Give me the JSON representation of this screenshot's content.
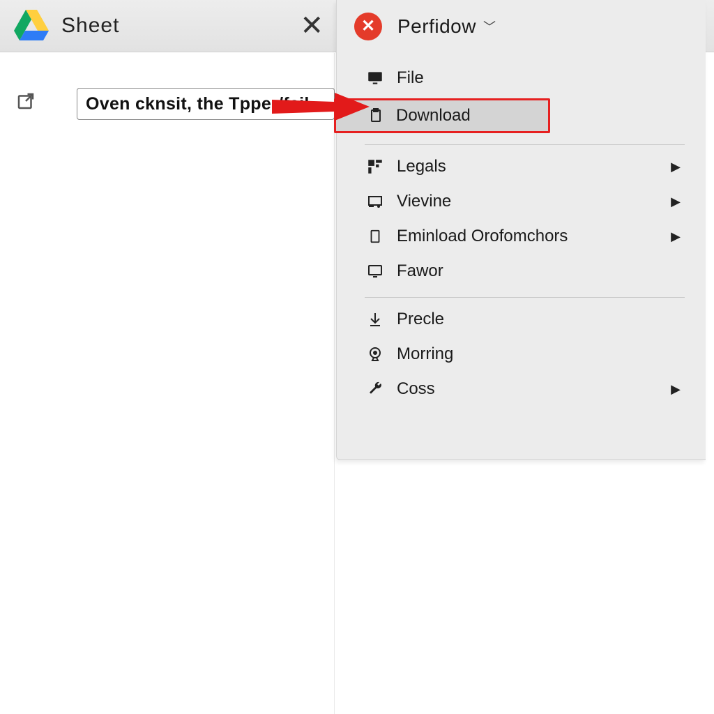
{
  "header": {
    "title": "Sheet"
  },
  "textbox": {
    "value": "Oven cknsit, the Tpper/fail"
  },
  "menu": {
    "title": "Perfidow",
    "groups": [
      {
        "items": [
          {
            "icon": "monitor-icon",
            "label": "File",
            "arrow": false,
            "highlight": false
          },
          {
            "icon": "clipboard-icon",
            "label": "Download",
            "arrow": false,
            "highlight": true
          }
        ]
      },
      {
        "items": [
          {
            "icon": "dashboard-icon",
            "label": "Legals",
            "arrow": true,
            "highlight": false
          },
          {
            "icon": "layout-icon",
            "label": "Vievine",
            "arrow": true,
            "highlight": false
          },
          {
            "icon": "page-icon",
            "label": "Eminload Orofomchors",
            "arrow": true,
            "highlight": false
          },
          {
            "icon": "screen-icon",
            "label": "Fawor",
            "arrow": false,
            "highlight": false
          }
        ]
      },
      {
        "items": [
          {
            "icon": "download-icon",
            "label": "Precle",
            "arrow": false,
            "highlight": false
          },
          {
            "icon": "webcam-icon",
            "label": "Morring",
            "arrow": false,
            "highlight": false
          },
          {
            "icon": "wrench-icon",
            "label": "Coss",
            "arrow": true,
            "highlight": false
          }
        ]
      }
    ]
  }
}
